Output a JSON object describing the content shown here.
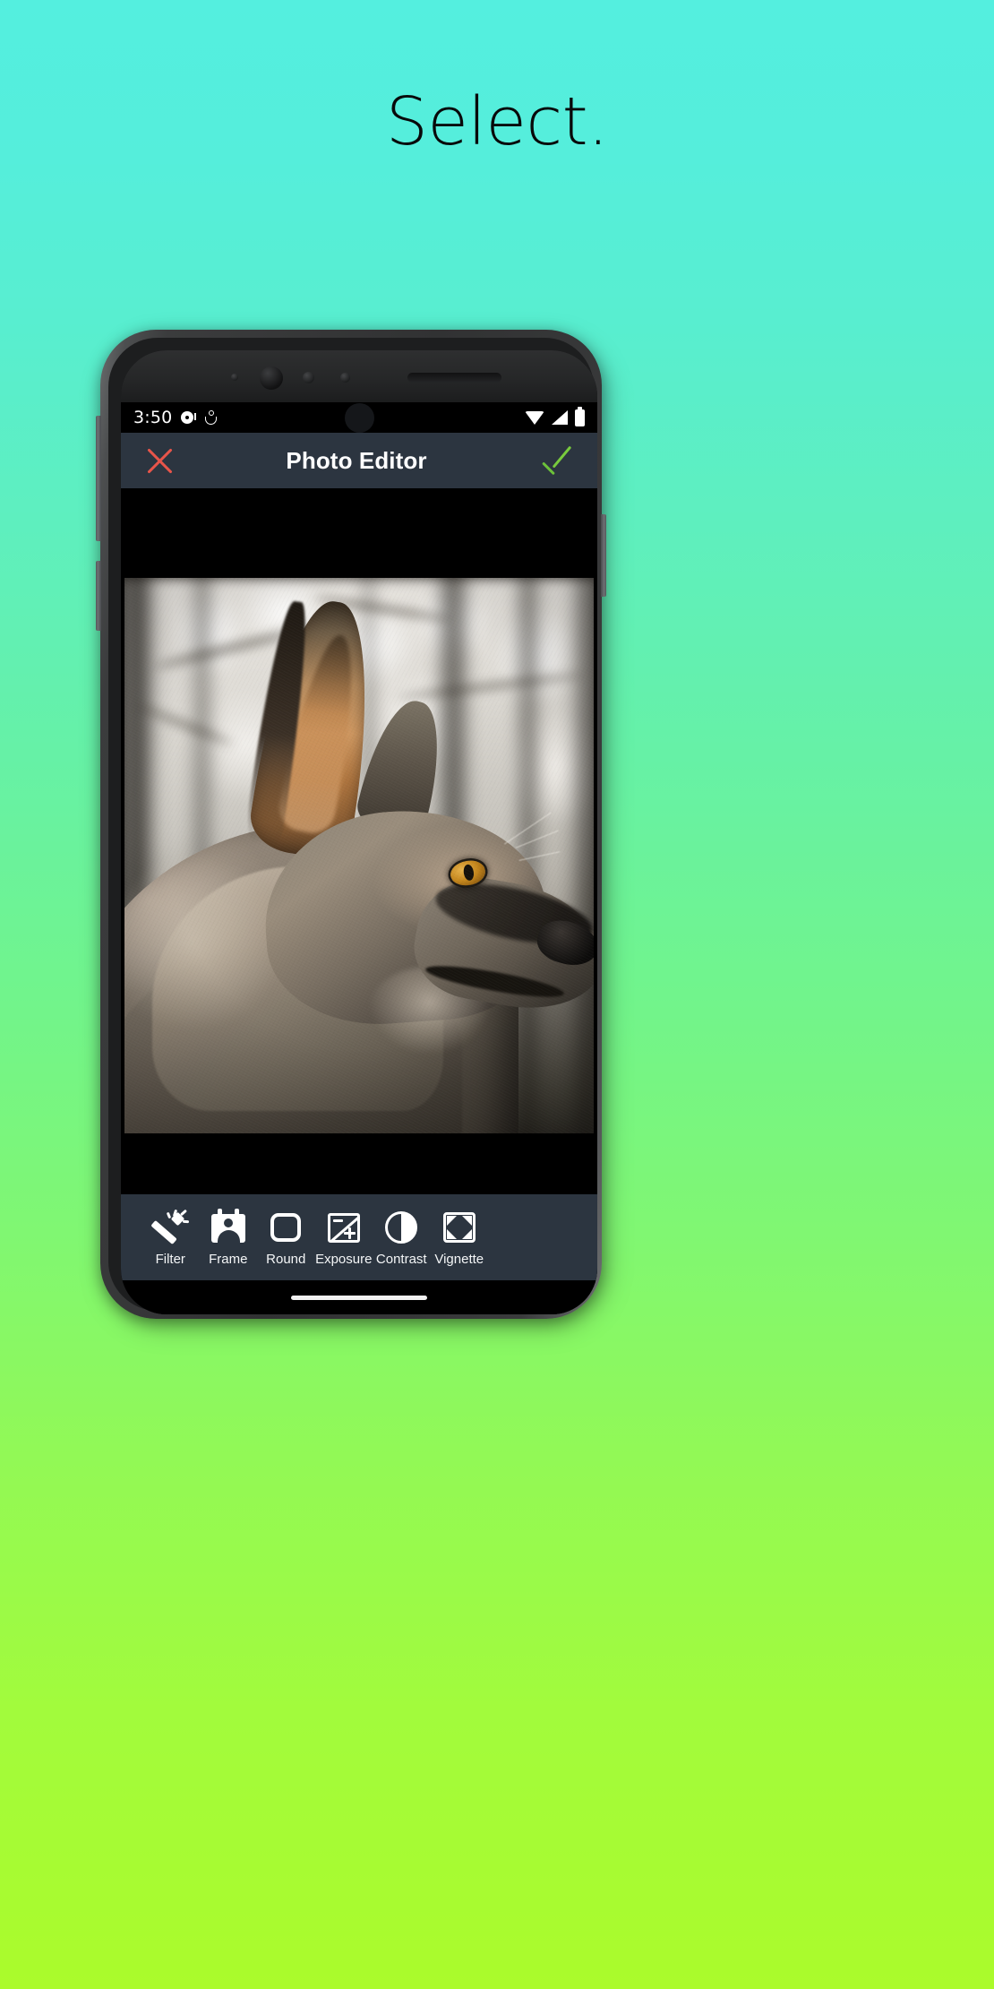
{
  "page": {
    "headline": "Select.",
    "background": {
      "gradient_from": "#54efdf",
      "gradient_to": "#abfb2b"
    }
  },
  "phone": {
    "status_bar": {
      "time": "3:50",
      "notification_icons": [
        "music-disc-icon",
        "person-walking-icon"
      ],
      "system_icons": [
        "wifi-icon",
        "cellular-signal-icon",
        "battery-icon"
      ],
      "background": "#000000"
    },
    "app_bar": {
      "title": "Photo Editor",
      "close_icon": "close-x-icon",
      "close_color": "#e8554a",
      "confirm_icon": "checkmark-icon",
      "confirm_color": "#78cb3d",
      "background": "#2c3540"
    },
    "canvas": {
      "background": "#000000",
      "image_description": "Close-up profile portrait of a grey wolf facing right, blurred winter forest background"
    },
    "toolbar": {
      "background": "#2c3540",
      "tools": [
        {
          "label": "Filter",
          "icon": "magic-wand-icon"
        },
        {
          "label": "Frame",
          "icon": "photo-frame-portrait-icon"
        },
        {
          "label": "Round",
          "icon": "rounded-square-icon"
        },
        {
          "label": "Exposure",
          "icon": "exposure-icon"
        },
        {
          "label": "Contrast",
          "icon": "contrast-half-circle-icon"
        },
        {
          "label": "Vignette",
          "icon": "vignette-corners-icon"
        }
      ]
    },
    "nav_bar": {
      "gesture_pill": "home-gesture-pill"
    }
  }
}
